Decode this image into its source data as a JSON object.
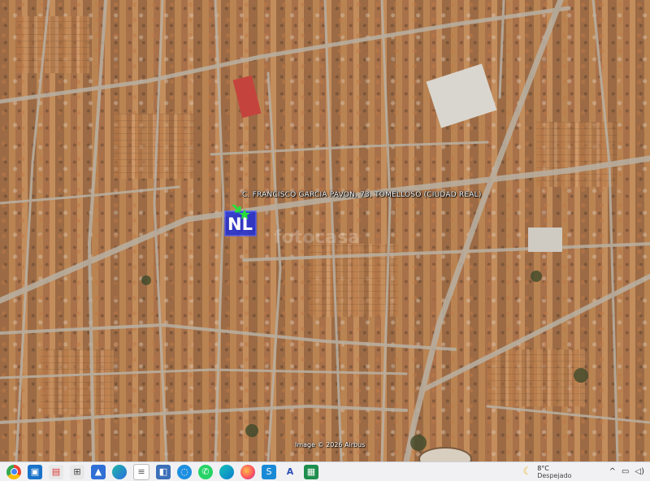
{
  "map": {
    "address_label": "C. FRANCISCO GARCIA PAVON, 73, TOMELLOSO (CIUDAD REAL)",
    "attribution": "Image © 2026 Airbus",
    "watermark": "fotocasa",
    "marker_letters": "NL",
    "colors": {
      "street": "#b9b1a4",
      "roof": "#c38d5c",
      "marker": "#1f2fd6",
      "arrow": "#27e03a"
    }
  },
  "taskbar": {
    "icons": [
      "chrome-icon",
      "file-explorer-icon",
      "store-icon",
      "network-icon",
      "photos-icon",
      "edge-icon",
      "document-icon",
      "gallery-icon",
      "phone-link-icon",
      "whatsapp-icon",
      "copilot-icon",
      "firefox-icon",
      "shazam-icon",
      "arrow-app-icon",
      "sheets-icon"
    ],
    "weather": {
      "temperature": "8°C",
      "condition": "Despejado"
    },
    "tray": [
      "chevron-up-icon",
      "device-icon",
      "speaker-icon"
    ],
    "colors": {
      "background": "#f1f1f3"
    }
  }
}
